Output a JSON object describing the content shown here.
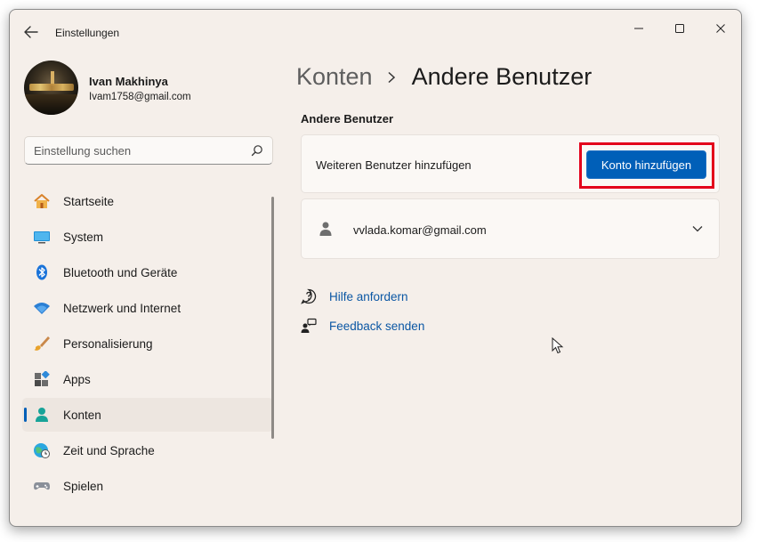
{
  "window": {
    "app_title": "Einstellungen"
  },
  "profile": {
    "name": "Ivan Makhinya",
    "email": "Ivam1758@gmail.com"
  },
  "search": {
    "placeholder": "Einstellung suchen",
    "icon": "search-icon"
  },
  "sidebar": {
    "items": [
      {
        "label": "Startseite",
        "icon": "home-icon"
      },
      {
        "label": "System",
        "icon": "monitor-icon"
      },
      {
        "label": "Bluetooth und Geräte",
        "icon": "bluetooth-icon"
      },
      {
        "label": "Netzwerk und Internet",
        "icon": "wifi-icon"
      },
      {
        "label": "Personalisierung",
        "icon": "brush-icon"
      },
      {
        "label": "Apps",
        "icon": "apps-icon"
      },
      {
        "label": "Konten",
        "icon": "person-icon",
        "active": true
      },
      {
        "label": "Zeit und Sprache",
        "icon": "globe-clock-icon"
      },
      {
        "label": "Spielen",
        "icon": "gamepad-icon"
      }
    ]
  },
  "breadcrumb": {
    "parent": "Konten",
    "current": "Andere Benutzer"
  },
  "content": {
    "section_title": "Andere Benutzer",
    "add_user_label": "Weiteren Benutzer hinzufügen",
    "add_button": "Konto hinzufügen",
    "user_account": "vvlada.komar@gmail.com"
  },
  "links": {
    "help": "Hilfe anfordern",
    "feedback": "Feedback senden"
  },
  "colors": {
    "accent": "#005fb8",
    "highlight": "#e3001b",
    "link": "#0b57a4",
    "background": "#f5efea"
  }
}
